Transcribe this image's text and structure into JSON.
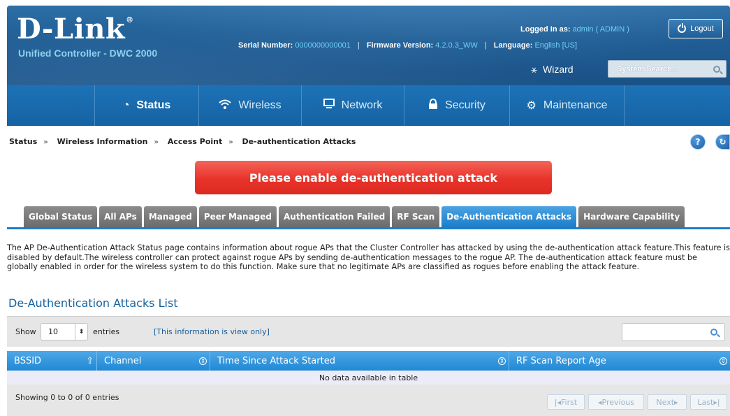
{
  "header": {
    "logo": "D-Link",
    "logo_mark": "®",
    "product": "Unified Controller - DWC 2000",
    "serial_label": "Serial Number:",
    "serial_value": "0000000000001",
    "firmware_label": "Firmware Version:",
    "firmware_value": "4.2.0.3_WW",
    "language_label": "Language:",
    "language_value": "English [US]",
    "logged_in_label": "Logged in as:",
    "logged_in_value": "admin ( ADMIN )",
    "logout_label": "Logout",
    "wizard_label": "Wizard",
    "system_search_placeholder": "System Search..."
  },
  "nav": {
    "items": [
      {
        "label": "Status",
        "icon": "dashboard-icon",
        "active": true
      },
      {
        "label": "Wireless",
        "icon": "wifi-icon"
      },
      {
        "label": "Network",
        "icon": "monitor-icon"
      },
      {
        "label": "Security",
        "icon": "lock-icon"
      },
      {
        "label": "Maintenance",
        "icon": "gears-icon"
      }
    ]
  },
  "breadcrumb": [
    "Status",
    "Wireless Information",
    "Access Point",
    "De-authentication Attacks"
  ],
  "help_label": "?",
  "alert": "Please enable de-authentication attack",
  "tabs": [
    {
      "label": "Global Status"
    },
    {
      "label": "All APs"
    },
    {
      "label": "Managed"
    },
    {
      "label": "Peer Managed"
    },
    {
      "label": "Authentication Failed"
    },
    {
      "label": "RF Scan"
    },
    {
      "label": "De-Authentication Attacks",
      "active": true
    },
    {
      "label": "Hardware Capability"
    }
  ],
  "description": "The AP De-Authentication Attack Status page contains information about rogue APs that the Cluster Controller has attacked by using the de-authentication attack feature.This feature is disabled by default.The wireless controller can protect against rogue APs by sending de-authentication messages to the rogue AP. The de-authentication attack feature must be globally enabled in order for the wireless system to do this function. Make sure that no legitimate APs are classified as rogues before enabling the attack feature.",
  "list_title": "De-Authentication Attacks List",
  "table": {
    "show_label": "Show",
    "entries_value": "10",
    "entries_label": "entries",
    "view_only": "[This information is view only]",
    "columns": [
      "BSSID",
      "Channel",
      "Time Since Attack Started",
      "RF Scan Report Age"
    ],
    "empty_message": "No data available in table",
    "info": "Showing 0 to 0 of 0 entries",
    "pager": {
      "first": "First",
      "previous": "Previous",
      "next": "Next",
      "last": "Last"
    }
  }
}
